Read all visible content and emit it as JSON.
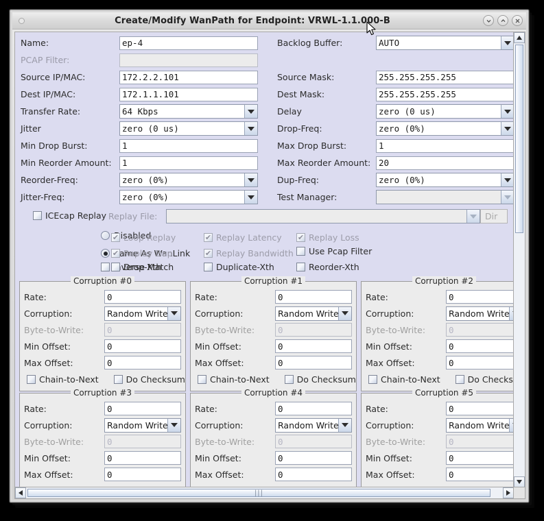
{
  "window": {
    "title": "Create/Modify WanPath for Endpoint: VRWL-1.1.000-B",
    "minimize_label": "⌄",
    "maximize_label": "⌃",
    "close_label": "✕"
  },
  "form": {
    "rows": [
      {
        "left_label": "Name:",
        "left_value": "ep-4",
        "left_type": "text",
        "right_label": "Backlog Buffer:",
        "right_value": "AUTO",
        "right_type": "combo"
      },
      {
        "left_label": "PCAP Filter:",
        "left_value": "",
        "left_type": "text",
        "left_disabled": true,
        "right_label": "",
        "right_value": "",
        "right_type": "none"
      },
      {
        "left_label": "Source IP/MAC:",
        "left_value": "172.2.2.101",
        "left_type": "text",
        "right_label": "Source Mask:",
        "right_value": "255.255.255.255",
        "right_type": "text"
      },
      {
        "left_label": "Dest IP/MAC:",
        "left_value": "172.1.1.101",
        "left_type": "text",
        "right_label": "Dest Mask:",
        "right_value": "255.255.255.255",
        "right_type": "text"
      },
      {
        "left_label": "Transfer Rate:",
        "left_value": "64 Kbps",
        "left_type": "combo",
        "right_label": "Delay",
        "right_value": "zero (0 us)",
        "right_type": "combo"
      },
      {
        "left_label": "Jitter",
        "left_value": "zero (0 us)",
        "left_type": "combo",
        "right_label": "Drop-Freq:",
        "right_value": "zero (0%)",
        "right_type": "combo"
      },
      {
        "left_label": "Min Drop Burst:",
        "left_value": "1",
        "left_type": "text",
        "right_label": "Max Drop Burst:",
        "right_value": "1",
        "right_type": "text"
      },
      {
        "left_label": "Min Reorder Amount:",
        "left_value": "1",
        "left_type": "text",
        "right_label": "Max Reorder Amount:",
        "right_value": "20",
        "right_type": "text"
      },
      {
        "left_label": "Reorder-Freq:",
        "left_value": "zero (0%)",
        "left_type": "combo",
        "right_label": "Dup-Freq:",
        "right_value": "zero (0%)",
        "right_type": "combo"
      },
      {
        "left_label": "Jitter-Freq:",
        "left_value": "zero (0%)",
        "left_type": "combo",
        "right_label": "Test Manager:",
        "right_value": "",
        "right_type": "combo",
        "right_disabled": true
      }
    ],
    "replay": {
      "icecap_label": "ICEcap Replay",
      "icecap_checked": false,
      "file_label": "Replay File:",
      "file_value": "",
      "dir_label": "Dir"
    },
    "options": {
      "row1": [
        {
          "name": "disabled",
          "kind": "radio",
          "label": "Disabled",
          "checked": false,
          "dim": false
        },
        {
          "name": "loop-replay",
          "kind": "check",
          "label": "Loop Replay",
          "checked": true,
          "dim": true
        },
        {
          "name": "replay-latency",
          "kind": "check",
          "label": "Replay Latency",
          "checked": true,
          "dim": true
        },
        {
          "name": "replay-loss",
          "kind": "check",
          "label": "Replay Loss",
          "checked": true,
          "dim": true
        }
      ],
      "row2": [
        {
          "name": "same-as-wanlink",
          "kind": "radio",
          "label": "Same As WanLink",
          "checked": true,
          "dim": false
        },
        {
          "name": "replay-dup",
          "kind": "check",
          "label": "Replay Dup",
          "checked": true,
          "dim": true
        },
        {
          "name": "replay-bandwidth",
          "kind": "check",
          "label": "Replay Bandwidth",
          "checked": true,
          "dim": true
        },
        {
          "name": "use-pcap-filter",
          "kind": "check",
          "label": "Use Pcap Filter",
          "checked": false,
          "dim": false
        }
      ],
      "row3": [
        {
          "name": "inverse-match",
          "kind": "check",
          "label": "Inverse Match",
          "checked": false,
          "dim": false
        },
        {
          "name": "drop-xth",
          "kind": "check",
          "label": "Drop-Xth",
          "checked": false,
          "dim": false
        },
        {
          "name": "duplicate-xth",
          "kind": "check",
          "label": "Duplicate-Xth",
          "checked": false,
          "dim": false
        },
        {
          "name": "reorder-xth",
          "kind": "check",
          "label": "Reorder-Xth",
          "checked": false,
          "dim": false
        }
      ]
    }
  },
  "corruption_labels": {
    "rate": "Rate:",
    "corruption": "Corruption:",
    "byte_to_write": "Byte-to-Write:",
    "min_offset": "Min Offset:",
    "max_offset": "Max Offset:",
    "chain_to_next": "Chain-to-Next",
    "do_checksum": "Do Checksum"
  },
  "corruption_panels": [
    {
      "title": "Corruption #0",
      "rate": "0",
      "corruption": "Random Write",
      "byte_to_write": "0",
      "min_offset": "0",
      "max_offset": "0",
      "chain_to_next": false,
      "do_checksum": false,
      "chain_disabled": false
    },
    {
      "title": "Corruption #1",
      "rate": "0",
      "corruption": "Random Write",
      "byte_to_write": "0",
      "min_offset": "0",
      "max_offset": "0",
      "chain_to_next": false,
      "do_checksum": false,
      "chain_disabled": false
    },
    {
      "title": "Corruption #2",
      "rate": "0",
      "corruption": "Random Write",
      "byte_to_write": "0",
      "min_offset": "0",
      "max_offset": "0",
      "chain_to_next": false,
      "do_checksum": false,
      "chain_disabled": false
    },
    {
      "title": "Corruption #3",
      "rate": "0",
      "corruption": "Random Write",
      "byte_to_write": "0",
      "min_offset": "0",
      "max_offset": "0",
      "chain_to_next": false,
      "do_checksum": false,
      "chain_disabled": false
    },
    {
      "title": "Corruption #4",
      "rate": "0",
      "corruption": "Random Write",
      "byte_to_write": "0",
      "min_offset": "0",
      "max_offset": "0",
      "chain_to_next": false,
      "do_checksum": false,
      "chain_disabled": false
    },
    {
      "title": "Corruption #5",
      "rate": "0",
      "corruption": "Random Write",
      "byte_to_write": "0",
      "min_offset": "0",
      "max_offset": "0",
      "chain_to_next": false,
      "do_checksum": false,
      "chain_disabled": true
    }
  ],
  "scrollbars": {
    "vertical_up": "▲",
    "vertical_down": "▼",
    "horizontal_left": "◀",
    "horizontal_right": "▶",
    "grip": "|||"
  },
  "colors": {
    "panel_bg": "#dcdcf0",
    "group_bg": "#ececec",
    "field_border": "#9aa2b4",
    "text": "#2b2b2b",
    "disabled_text": "#9d9daa",
    "title_bar": "#e4e4e4"
  }
}
